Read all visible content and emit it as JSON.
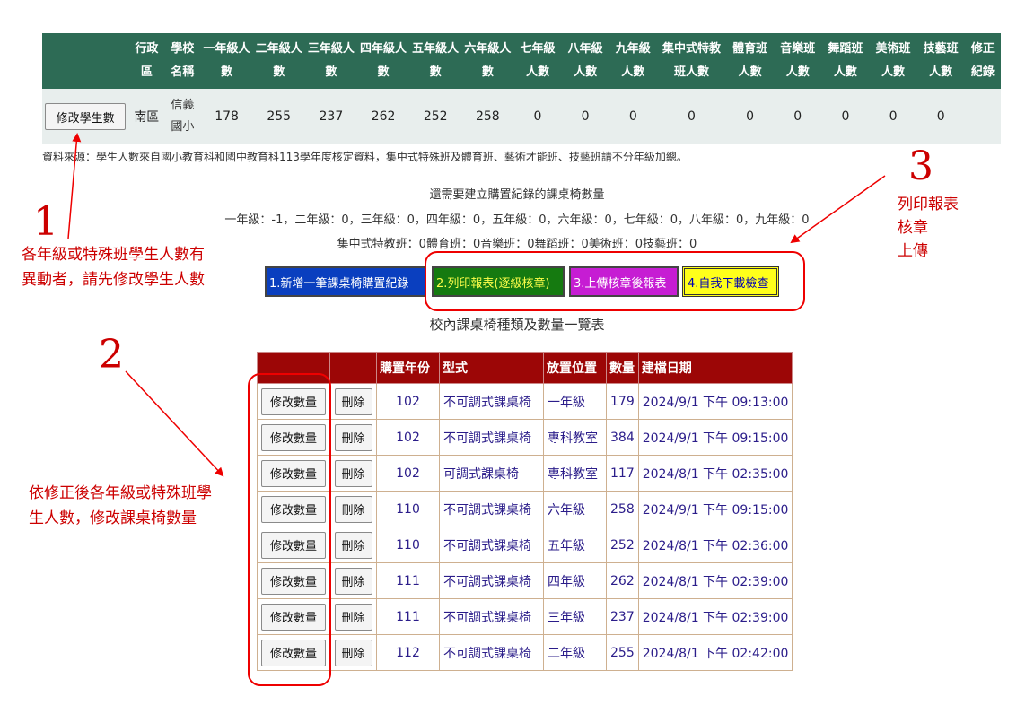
{
  "summary": {
    "headers": [
      "",
      "行政區",
      "學校名稱",
      "一年級人數",
      "二年級人數",
      "三年級人數",
      "四年級人數",
      "五年級人數",
      "六年級人數",
      "七年級人數",
      "八年級人數",
      "九年級人數",
      "集中式特教班人數",
      "體育班人數",
      "音樂班人數",
      "舞蹈班人數",
      "美術班人數",
      "技藝班人數",
      "修正紀錄"
    ],
    "edit_button": "修改學生數",
    "district": "南區",
    "school": "信義國小",
    "counts": [
      "178",
      "255",
      "237",
      "262",
      "252",
      "258",
      "0",
      "0",
      "0",
      "0",
      "0",
      "0",
      "0",
      "0",
      "0"
    ],
    "revision": ""
  },
  "source_note": "資料來源：學生人數來自國小教育科和國中教育科113學年度核定資料，集中式特殊班及體育班、藝術才能班、技藝班請不分年級加總。",
  "remaining": {
    "title": "還需要建立購置紀錄的課桌椅數量",
    "grades": "一年級：-1，二年級：0，三年級：0，四年級：0，五年級：0，六年級：0，七年級：0，八年級：0，九年級：0",
    "special": "集中式特教班：0體育班：0音樂班：0舞蹈班：0美術班：0技藝班：0"
  },
  "actions": {
    "add": "1.新增一筆課桌椅購置紀錄",
    "print": "2.列印報表(逐級核章)",
    "upload": "3.上傳核章後報表",
    "download": "4.自我下載檢查"
  },
  "list_title": "校內課桌椅種類及數量一覽表",
  "desks": {
    "headers": [
      "",
      "",
      "購置年份",
      "型式",
      "放置位置",
      "數量",
      "建檔日期"
    ],
    "modify_label": "修改數量",
    "delete_label": "刪除",
    "rows": [
      {
        "year": "102",
        "type": "不可調式課桌椅",
        "location": "一年級",
        "qty": "179",
        "date": "2024/9/1 下午 09:13:00"
      },
      {
        "year": "102",
        "type": "不可調式課桌椅",
        "location": "專科教室",
        "qty": "384",
        "date": "2024/9/1 下午 09:15:00"
      },
      {
        "year": "102",
        "type": "可調式課桌椅",
        "location": "專科教室",
        "qty": "117",
        "date": "2024/8/1 下午 02:35:00"
      },
      {
        "year": "110",
        "type": "不可調式課桌椅",
        "location": "六年級",
        "qty": "258",
        "date": "2024/9/1 下午 09:15:00"
      },
      {
        "year": "110",
        "type": "不可調式課桌椅",
        "location": "五年級",
        "qty": "252",
        "date": "2024/8/1 下午 02:36:00"
      },
      {
        "year": "111",
        "type": "不可調式課桌椅",
        "location": "四年級",
        "qty": "262",
        "date": "2024/8/1 下午 02:39:00"
      },
      {
        "year": "111",
        "type": "不可調式課桌椅",
        "location": "三年級",
        "qty": "237",
        "date": "2024/8/1 下午 02:39:00"
      },
      {
        "year": "112",
        "type": "不可調式課桌椅",
        "location": "二年級",
        "qty": "255",
        "date": "2024/8/1 下午 02:42:00"
      }
    ]
  },
  "annotations": {
    "n1": "1",
    "note1_line1": "各年級或特殊班學生人數有",
    "note1_line2": "異動者，請先修改學生人數",
    "n2": "2",
    "note2_line1": "依修正後各年級或特殊班學",
    "note2_line2": "生人數，修改課桌椅數量",
    "n3": "3",
    "note3_line1": "列印報表",
    "note3_line2": "核章",
    "note3_line3": "上傳"
  },
  "colors": {
    "header_green": "#2d6b55",
    "header_red": "#9c0606",
    "annotation_red": "#cc0000"
  }
}
